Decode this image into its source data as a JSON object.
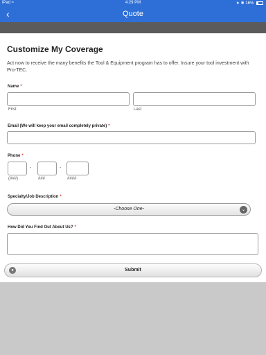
{
  "status_bar": {
    "carrier": "iPad",
    "time": "4:29 PM",
    "battery": "16%",
    "wifi_icon": "wifi-icon",
    "location_icon": "location-arrow-icon",
    "bluetooth_icon": "bluetooth-icon"
  },
  "nav": {
    "title": "Quote",
    "back_glyph": "‹"
  },
  "form": {
    "title": "Customize My Coverage",
    "intro": "Act now to receive the many benefits the Tool & Equipment program has to offer. Insure your tool investment with Pro-TEC.",
    "required_mark": "*",
    "name": {
      "label": "Name",
      "first": "First",
      "last": "Last"
    },
    "email": {
      "label": "Email (We will keep your email completely private)"
    },
    "phone": {
      "label": "Phone",
      "separator": "-",
      "area": "(###)",
      "prefix": "###",
      "line": "####"
    },
    "specialty": {
      "label": "Specialty/Job Description",
      "selected": "-Choose One-"
    },
    "referral": {
      "label": "How Did You Find Out About Us?"
    },
    "submit_label": "Submit"
  }
}
